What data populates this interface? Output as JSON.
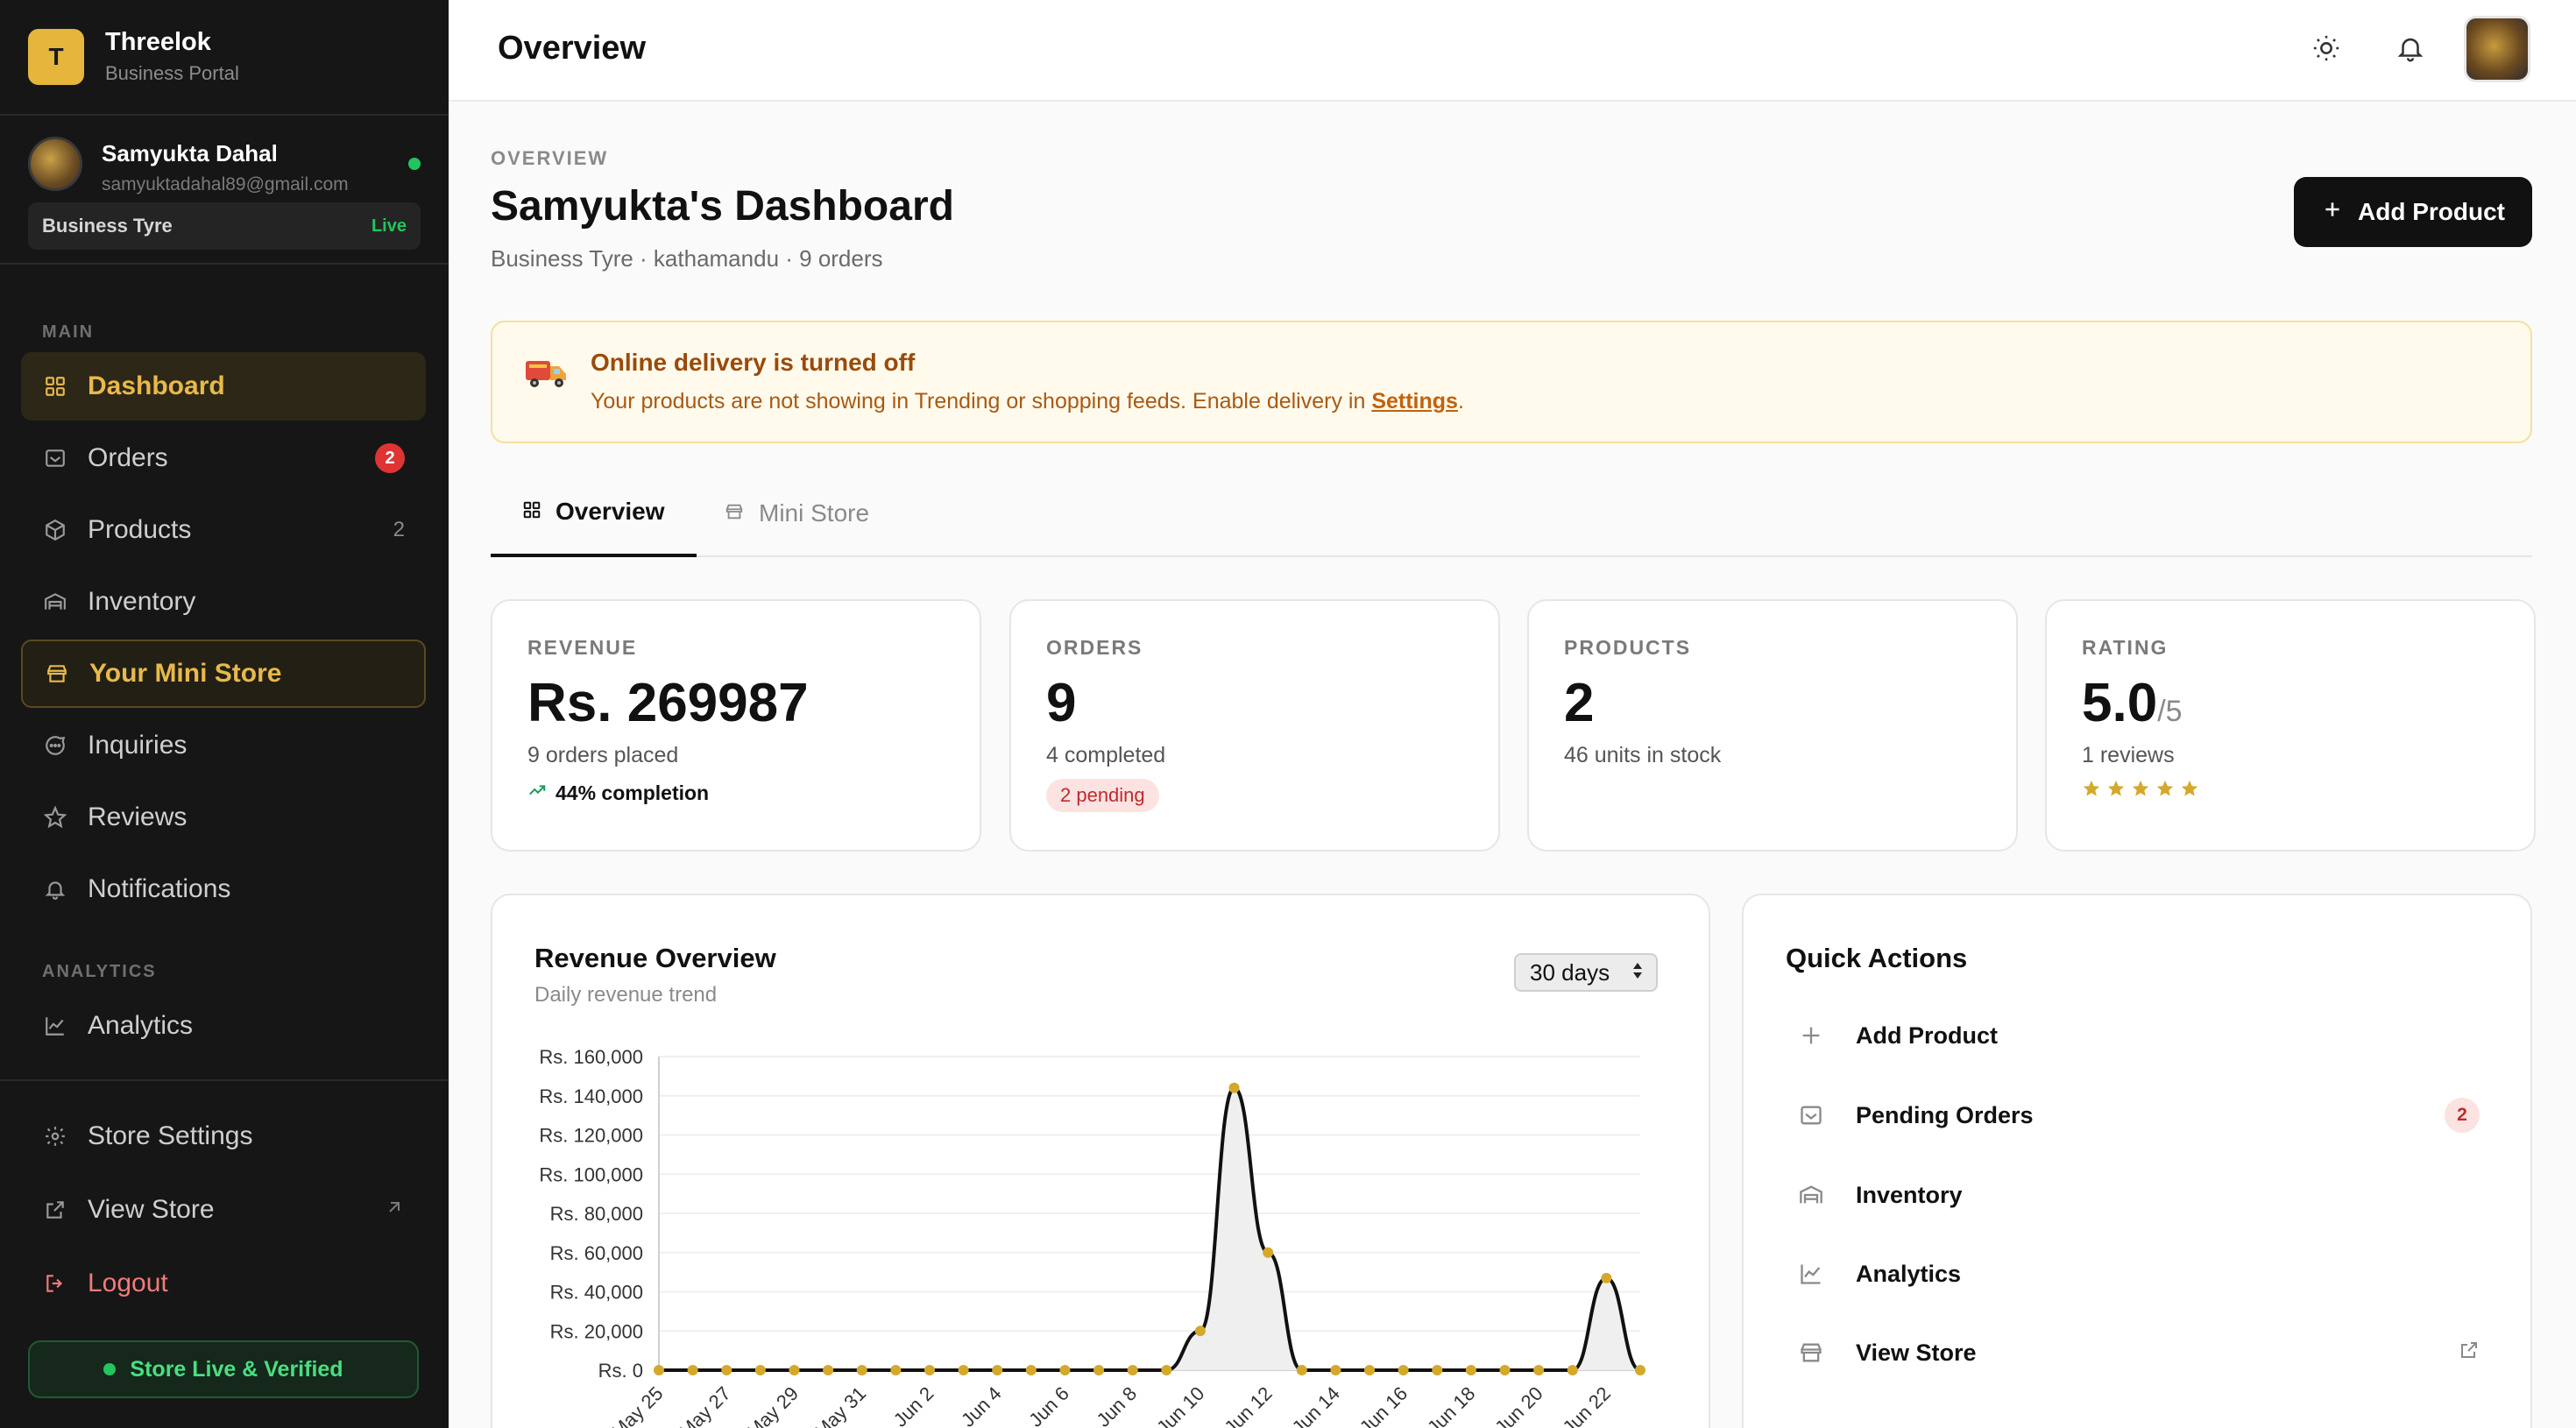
{
  "brand": {
    "logo_letter": "T",
    "name": "Threelok",
    "subtitle": "Business Portal"
  },
  "user": {
    "name": "Samyukta Dahal",
    "email": "samyuktadahal89@gmail.com",
    "business": "Business Tyre",
    "status": "Live"
  },
  "nav": {
    "main_label": "MAIN",
    "analytics_label": "ANALYTICS",
    "items": [
      {
        "label": "Dashboard",
        "icon": "grid-icon"
      },
      {
        "label": "Orders",
        "icon": "inbox-icon",
        "badge": "2"
      },
      {
        "label": "Products",
        "icon": "box-icon",
        "count": "2"
      },
      {
        "label": "Inventory",
        "icon": "warehouse-icon"
      },
      {
        "label": "Your Mini Store",
        "icon": "store-icon"
      },
      {
        "label": "Inquiries",
        "icon": "chat-icon"
      },
      {
        "label": "Reviews",
        "icon": "star-icon"
      },
      {
        "label": "Notifications",
        "icon": "bell-icon"
      },
      {
        "label": "Analytics",
        "icon": "chart-line-icon"
      }
    ],
    "footer": [
      {
        "label": "Store Settings",
        "icon": "gear-icon"
      },
      {
        "label": "View Store",
        "icon": "external-link-icon"
      },
      {
        "label": "Logout",
        "icon": "logout-icon"
      }
    ],
    "store_status": "Store Live & Verified"
  },
  "topbar": {
    "title": "Overview"
  },
  "header": {
    "eyebrow": "OVERVIEW",
    "title": "Samyukta's Dashboard",
    "subtitle": "Business Tyre · kathamandu · 9 orders",
    "add_button": "Add Product"
  },
  "banner": {
    "title": "Online delivery is turned off",
    "text": "Your products are not showing in Trending or shopping feeds. Enable delivery in ",
    "link": "Settings",
    "tail": "."
  },
  "tabs": [
    {
      "label": "Overview"
    },
    {
      "label": "Mini Store"
    }
  ],
  "stats": {
    "revenue": {
      "label": "REVENUE",
      "value": "Rs. 269987",
      "sub": "9 orders placed",
      "extra": "44% completion"
    },
    "orders": {
      "label": "ORDERS",
      "value": "9",
      "sub": "4 completed",
      "pill": "2 pending"
    },
    "products": {
      "label": "PRODUCTS",
      "value": "2",
      "sub": "46 units in stock"
    },
    "rating": {
      "label": "RATING",
      "value": "5.0",
      "suffix": "/5",
      "sub": "1 reviews",
      "stars": 5
    }
  },
  "revenue_chart": {
    "title": "Revenue Overview",
    "subtitle": "Daily revenue trend",
    "range": "30 days"
  },
  "chart_data": {
    "type": "area",
    "x": [
      "May 25",
      "May 26",
      "May 27",
      "May 28",
      "May 29",
      "May 30",
      "May 31",
      "Jun 1",
      "Jun 2",
      "Jun 3",
      "Jun 4",
      "Jun 5",
      "Jun 6",
      "Jun 7",
      "Jun 8",
      "Jun 9",
      "Jun 10",
      "Jun 11",
      "Jun 12",
      "Jun 13",
      "Jun 14",
      "Jun 15",
      "Jun 16",
      "Jun 17",
      "Jun 18",
      "Jun 19",
      "Jun 20",
      "Jun 21",
      "Jun 22",
      "Jun 23"
    ],
    "tick_labels": [
      "May 25",
      "May 27",
      "May 29",
      "May 31",
      "Jun 2",
      "Jun 4",
      "Jun 6",
      "Jun 8",
      "Jun 10",
      "Jun 12",
      "Jun 14",
      "Jun 16",
      "Jun 18",
      "Jun 20",
      "Jun 22"
    ],
    "values": [
      0,
      0,
      0,
      0,
      0,
      0,
      0,
      0,
      0,
      0,
      0,
      0,
      0,
      0,
      0,
      0,
      20000,
      144000,
      60000,
      0,
      0,
      0,
      0,
      0,
      0,
      0,
      0,
      0,
      47000,
      0
    ],
    "ylim": [
      0,
      160000
    ],
    "yticks": [
      "Rs. 0",
      "Rs. 20,000",
      "Rs. 40,000",
      "Rs. 60,000",
      "Rs. 80,000",
      "Rs. 100,000",
      "Rs. 120,000",
      "Rs. 140,000",
      "Rs. 160,000"
    ],
    "line_color": "#111111",
    "point_color": "#d4a92b",
    "fill_color": "#efefef",
    "grid": true
  },
  "quick_actions": {
    "title": "Quick Actions",
    "items": [
      {
        "label": "Add Product",
        "icon": "plus-icon"
      },
      {
        "label": "Pending Orders",
        "icon": "inbox-icon",
        "badge": "2"
      },
      {
        "label": "Inventory",
        "icon": "warehouse-icon"
      },
      {
        "label": "Analytics",
        "icon": "chart-line-icon"
      },
      {
        "label": "View Store",
        "icon": "store-icon"
      }
    ]
  }
}
